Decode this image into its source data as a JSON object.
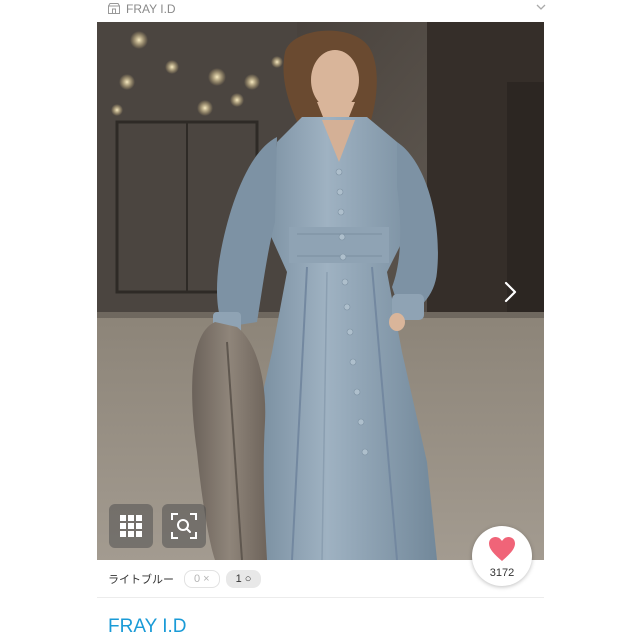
{
  "header": {
    "brand_name": "FRAY I.D"
  },
  "photo": {
    "alt": "Woman in light blue long dress holding a taupe coat"
  },
  "variant": {
    "color_label": "ライトブルー",
    "out_of_stock_text": "0 ×",
    "in_stock_text": "1 ○"
  },
  "likes": {
    "count": "3172"
  },
  "brand_link": {
    "label": "FRAY I.D"
  },
  "colors": {
    "accent_link": "#1a9bd7",
    "heart": "#f06478"
  }
}
